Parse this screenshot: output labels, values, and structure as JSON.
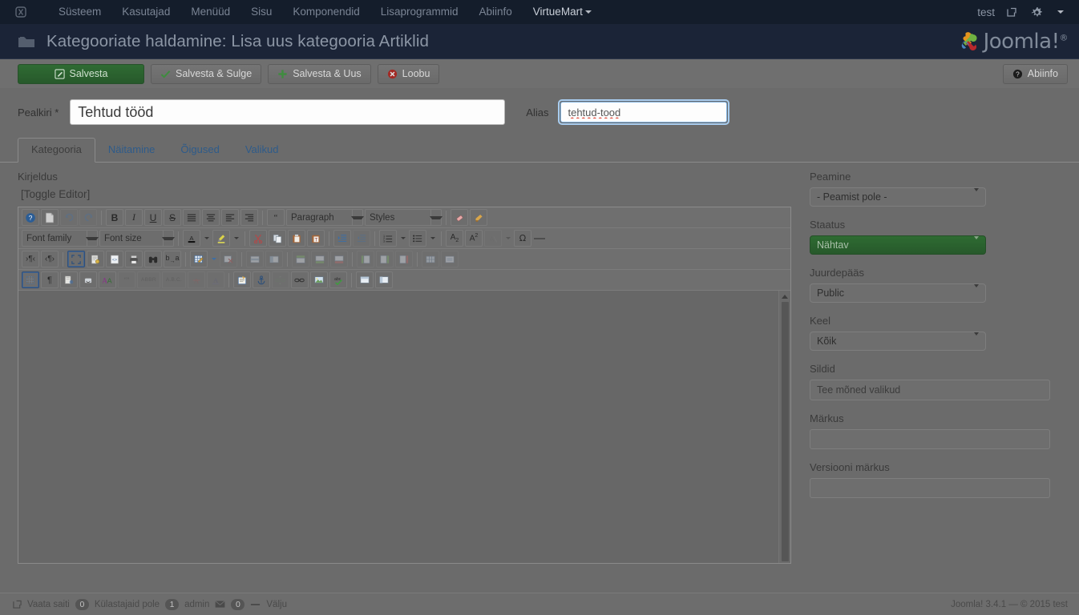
{
  "topnav": {
    "logo_icon": "joomla-mark-icon",
    "items": [
      {
        "label": "Süsteem",
        "name": "nav-item-system"
      },
      {
        "label": "Kasutajad",
        "name": "nav-item-users"
      },
      {
        "label": "Menüüd",
        "name": "nav-item-menus"
      },
      {
        "label": "Sisu",
        "name": "nav-item-content"
      },
      {
        "label": "Komponendid",
        "name": "nav-item-components"
      },
      {
        "label": "Lisaprogrammid",
        "name": "nav-item-extensions"
      },
      {
        "label": "Abiinfo",
        "name": "nav-item-help"
      }
    ],
    "active_item": "VirtueMart",
    "user": "test",
    "user_icon": "external-link-icon",
    "gear_icon": "gear-icon",
    "chevron_icon": "chevron-down-icon"
  },
  "header": {
    "icon": "folder-icon",
    "title": "Kategooriate haldamine: Lisa uus kategooria Artiklid",
    "brand": "Joomla!",
    "brand_sup": "®"
  },
  "toolbar": {
    "save": "Salvesta",
    "save_icon": "pencil-square-icon",
    "save_close": "Salvesta & Sulge",
    "save_close_icon": "check-icon",
    "save_new": "Salvesta & Uus",
    "save_new_icon": "plus-icon",
    "cancel": "Loobu",
    "cancel_icon": "cancel-circle-icon",
    "help": "Abiinfo",
    "help_icon": "question-circle-icon",
    "primary_color": "#2f6b33"
  },
  "titlerow": {
    "title_label": "Pealkiri *",
    "title_value": "Tehtud tööd",
    "alias_label": "Alias",
    "alias_value": "tehtud-tood",
    "focus_color": "#7fb1e0"
  },
  "tabs": [
    {
      "label": "Kategooria",
      "name": "tab-kategooria",
      "active": true
    },
    {
      "label": "Näitamine",
      "name": "tab-naitamine",
      "active": false
    },
    {
      "label": "Õigused",
      "name": "tab-oigused",
      "active": false
    },
    {
      "label": "Valikud",
      "name": "tab-valikud",
      "active": false
    }
  ],
  "editor": {
    "description_label": "Kirjeldus",
    "toggle_editor": "[Toggle Editor]",
    "body_value": "",
    "paragraph_select": "Paragraph",
    "styles_select": "Styles",
    "fontfamily_select": "Font family",
    "fontsize_select": "Font size",
    "row1_icons": [
      "help-circle-icon",
      "new-document-icon",
      "undo-icon",
      "redo-icon",
      "bold-icon",
      "italic-icon",
      "underline-icon",
      "strikethrough-icon",
      "align-justify-icon",
      "align-center-icon",
      "align-left-icon",
      "align-right-icon",
      "blockquote-icon"
    ],
    "row1_tail_icons": [
      "eraser-icon",
      "cleanup-broom-icon"
    ],
    "row2_icons": [
      "text-color-icon",
      "highlight-color-icon",
      "cut-scissors-icon",
      "copy-icon",
      "paste-icon",
      "paste-as-text-icon",
      "indent-icon",
      "outdent-icon",
      "numbered-list-icon",
      "bullet-list-icon",
      "subscript-icon",
      "superscript-icon",
      "remove-format-icon",
      "special-character-icon",
      "horizontal-rule-icon"
    ],
    "row3_icons": [
      "ltr-icon",
      "rtl-icon",
      "fullscreen-icon",
      "source-preview-icon",
      "code-icon",
      "print-icon",
      "search-binoculars-icon",
      "find-replace-icon",
      "table-icon",
      "delete-table-icon",
      "table-row-properties-icon",
      "table-cell-properties-icon",
      "insert-row-before-icon",
      "insert-row-after-icon",
      "delete-row-icon",
      "insert-col-before-icon",
      "insert-col-after-icon",
      "delete-col-icon",
      "split-cells-icon",
      "merge-cells-icon"
    ],
    "row4_icons": [
      "visual-aid-grid-icon",
      "pilcrow-icon",
      "page-break-icon",
      "emoticon-icon",
      "font-select-icon",
      "quote-icon",
      "abbreviation-icon",
      "acronym-icon",
      "delete-text-icon",
      "insert-text-icon",
      "template-icon",
      "anchor-icon",
      "unlink-icon",
      "link-icon",
      "image-icon",
      "spellcheck-icon",
      "iframe-layers-icon",
      "panel-icon"
    ]
  },
  "sidebar": {
    "parent_label": "Peamine",
    "parent_value": "- Peamist pole -",
    "status_label": "Staatus",
    "status_value": "Nähtav",
    "status_color": "#2e6b32",
    "access_label": "Juurdepääs",
    "access_value": "Public",
    "language_label": "Keel",
    "language_value": "Kõik",
    "tags_label": "Sildid",
    "tags_placeholder": "Tee mõned valikud",
    "note_label": "Märkus",
    "note_value": "",
    "version_note_label": "Versiooni märkus",
    "version_note_value": ""
  },
  "footer": {
    "view_site": "Vaata saiti",
    "view_site_icon": "external-link-icon",
    "visitors_badge": "0",
    "visitors_label": "Külastajaid pole",
    "admin_badge": "1",
    "admin_label": "admin",
    "mail_icon": "envelope-icon",
    "mail_badge": "0",
    "logout_icon": "power-icon",
    "logout_label": "Välju",
    "copyright": "Joomla! 3.4.1  —  © 2015 test"
  }
}
